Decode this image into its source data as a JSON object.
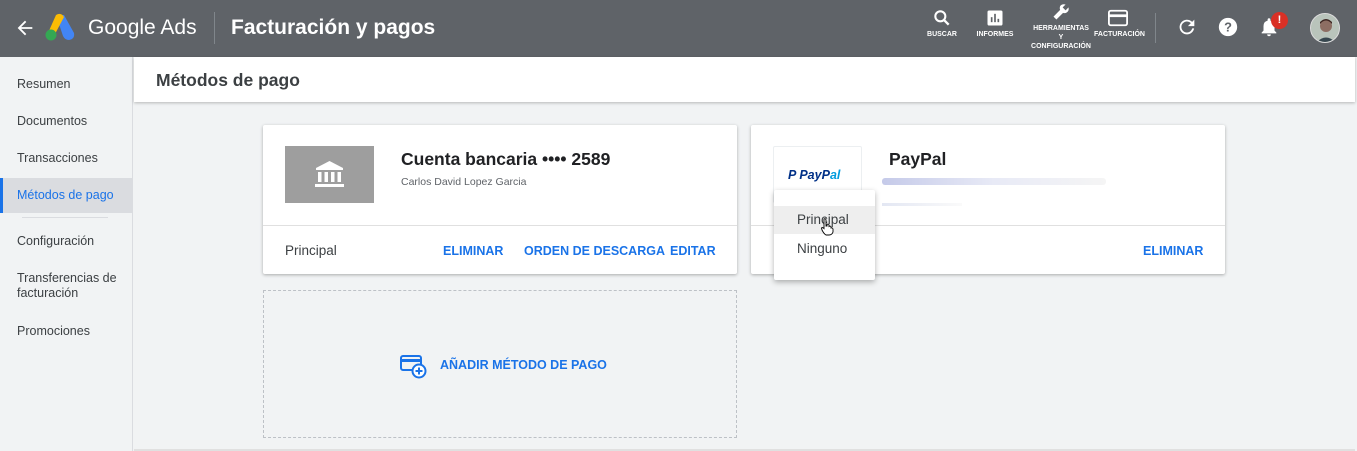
{
  "topbar": {
    "brand": "Google Ads",
    "title": "Facturación y pagos",
    "tools": {
      "search": "BUSCAR",
      "reports": "INFORMES",
      "tools_line1": "HERRAMIENTAS",
      "tools_line2": "Y",
      "tools_line3": "CONFIGURACIÓN",
      "billing": "FACTURACIÓN"
    },
    "notification_badge": "!"
  },
  "sidebar": {
    "items": [
      {
        "label": "Resumen"
      },
      {
        "label": "Documentos"
      },
      {
        "label": "Transacciones"
      },
      {
        "label": "Métodos de pago"
      },
      {
        "label": "Configuración"
      },
      {
        "label": "Transferencias de facturación"
      },
      {
        "label": "Promociones"
      }
    ]
  },
  "page": {
    "heading": "Métodos de pago"
  },
  "bank_card": {
    "title": "Cuenta bancaria •••• 2589",
    "holder": "Carlos David Lopez Garcia",
    "status": "Principal",
    "actions": {
      "delete": "ELIMINAR",
      "order": "ORDEN DE DESCARGA",
      "edit": "EDITAR"
    }
  },
  "paypal_card": {
    "logo_text_1": "P PayP",
    "logo_text_2": "al",
    "title": "PayPal",
    "actions": {
      "delete": "ELIMINAR"
    }
  },
  "dropdown": {
    "options": [
      "Principal",
      "Ninguno"
    ],
    "highlighted": "Principal"
  },
  "add_method": {
    "label": "AÑADIR MÉTODO DE PAGO"
  },
  "colors": {
    "topbar": "#5f6368",
    "accent": "#1a73e8",
    "alert": "#d93025"
  }
}
